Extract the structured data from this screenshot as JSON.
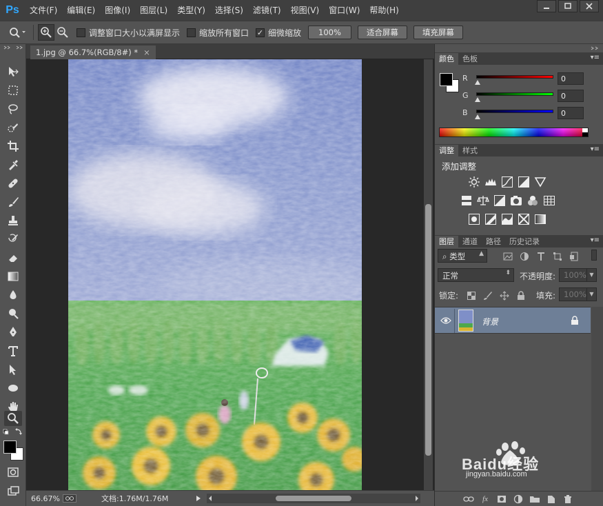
{
  "app": {
    "logo": "Ps"
  },
  "menubar": {
    "items": [
      "文件(F)",
      "编辑(E)",
      "图像(I)",
      "图层(L)",
      "类型(Y)",
      "选择(S)",
      "滤镜(T)",
      "视图(V)",
      "窗口(W)",
      "帮助(H)"
    ]
  },
  "options": {
    "resize_windows_label": "调整窗口大小以满屏显示",
    "resize_windows_checked": false,
    "zoom_all_label": "缩放所有窗口",
    "zoom_all_checked": false,
    "scrubby_zoom_label": "细微缩放",
    "scrubby_zoom_checked": true,
    "checkmark": "✓",
    "btn_100": "100%",
    "btn_fit": "适合屏幕",
    "btn_fill": "填充屏幕"
  },
  "document": {
    "tab_title": "1.jpg @ 66.7%(RGB/8#) *",
    "tab_close": "×"
  },
  "status": {
    "zoom": "66.67%",
    "doc_info": "文档:1.76M/1.76M"
  },
  "color_panel": {
    "tab_color": "颜色",
    "tab_swatches": "色板",
    "r_label": "R",
    "g_label": "G",
    "b_label": "B",
    "r_value": "0",
    "g_value": "0",
    "b_value": "0",
    "foreground": "#000000",
    "background": "#ffffff"
  },
  "adjust_panel": {
    "tab_adjust": "调整",
    "tab_styles": "样式",
    "heading": "添加调整"
  },
  "layers_panel": {
    "tab_layers": "图层",
    "tab_channels": "通道",
    "tab_paths": "路径",
    "tab_history": "历史记录",
    "filter_kind": "类型",
    "blend_mode": "正常",
    "opacity_label": "不透明度:",
    "opacity_value": "100%",
    "lock_label": "锁定:",
    "fill_label": "填充:",
    "fill_value": "100%",
    "layer_name": "背景"
  },
  "watermark": {
    "text": "Baidu经验",
    "url_text": "jingyan.baidu.com"
  },
  "colors": {
    "accent": "#31a8ff",
    "layer_selected": "#6e7f97"
  }
}
